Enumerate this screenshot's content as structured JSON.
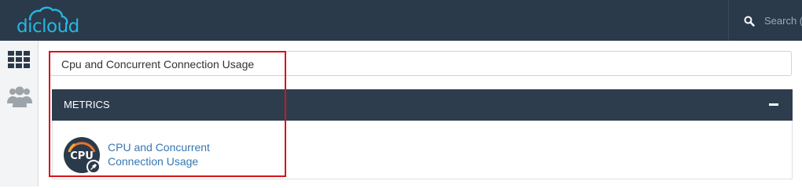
{
  "header": {
    "logo_text": "dicloud",
    "search_placeholder": "Search (",
    "brand_color": "#26b6e3",
    "bar_color": "#2b3a4a"
  },
  "sidebar": {
    "items": [
      {
        "icon": "grid-icon"
      },
      {
        "icon": "users-icon"
      }
    ]
  },
  "main": {
    "search_value": "Cpu and Concurrent Connection Usage",
    "panel": {
      "title": "METRICS",
      "collapse_icon": "minus-icon",
      "item": {
        "icon_label": "CPU",
        "label_line1": "CPU and Concurrent",
        "label_line2": "Connection Usage",
        "link_color": "#3577b3"
      }
    },
    "highlight_color": "#d4141b"
  }
}
